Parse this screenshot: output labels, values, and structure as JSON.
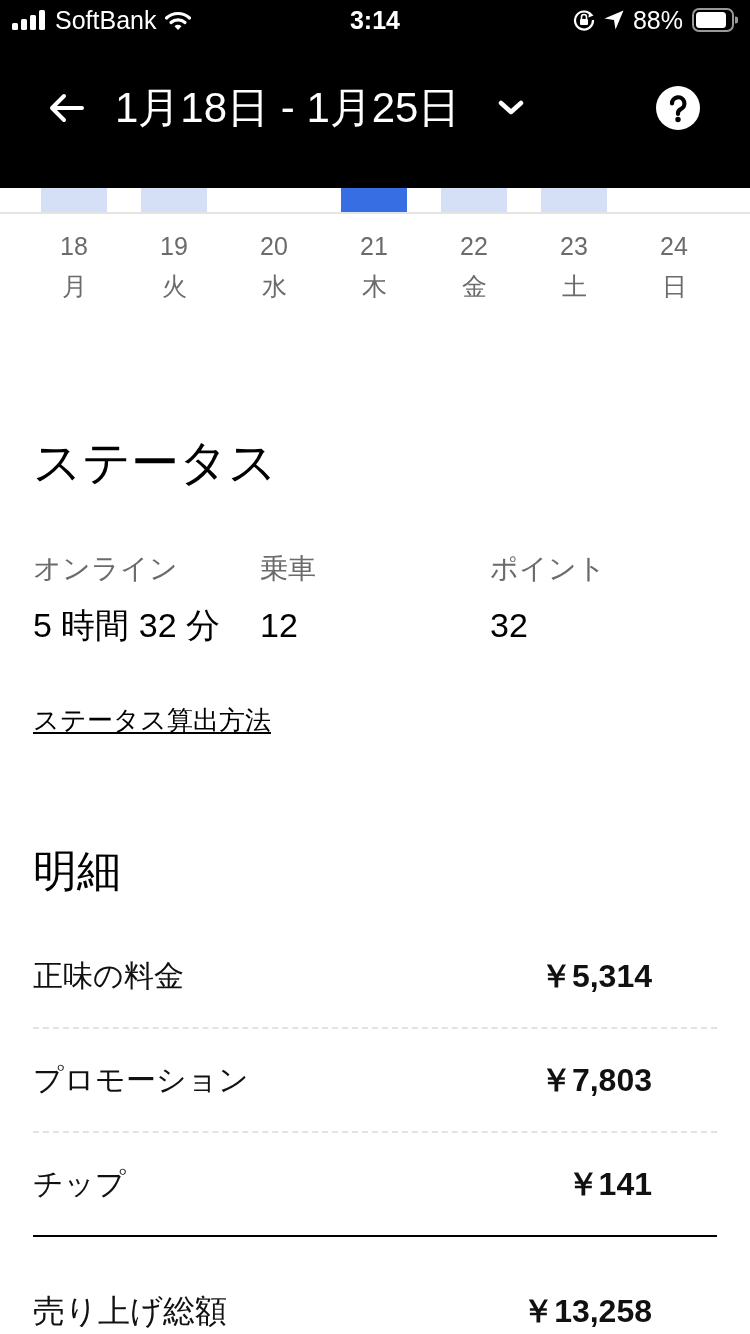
{
  "status_bar": {
    "carrier": "SoftBank",
    "time": "3:14",
    "battery": "88%"
  },
  "header": {
    "title": "1月18日 - 1月25日"
  },
  "days": [
    {
      "date": "18",
      "weekday": "月",
      "has_bar": true,
      "selected": false
    },
    {
      "date": "19",
      "weekday": "火",
      "has_bar": true,
      "selected": false
    },
    {
      "date": "20",
      "weekday": "水",
      "has_bar": false,
      "selected": false
    },
    {
      "date": "21",
      "weekday": "木",
      "has_bar": true,
      "selected": true
    },
    {
      "date": "22",
      "weekday": "金",
      "has_bar": true,
      "selected": false
    },
    {
      "date": "23",
      "weekday": "土",
      "has_bar": true,
      "selected": false
    },
    {
      "date": "24",
      "weekday": "日",
      "has_bar": false,
      "selected": false
    }
  ],
  "status": {
    "title": "ステータス",
    "stats": [
      {
        "label": "オンライン",
        "value": "5 時間 32 分"
      },
      {
        "label": "乗車",
        "value": "12"
      },
      {
        "label": "ポイント",
        "value": "32"
      }
    ],
    "link": "ステータス算出方法"
  },
  "breakdown": {
    "title": "明細",
    "items": [
      {
        "label": "正味の料金",
        "amount": "￥5,314"
      },
      {
        "label": "プロモーション",
        "amount": "￥7,803"
      },
      {
        "label": "チップ",
        "amount": "￥141"
      }
    ],
    "total": {
      "label": "売り上げ総額",
      "amount": "￥13,258"
    }
  }
}
